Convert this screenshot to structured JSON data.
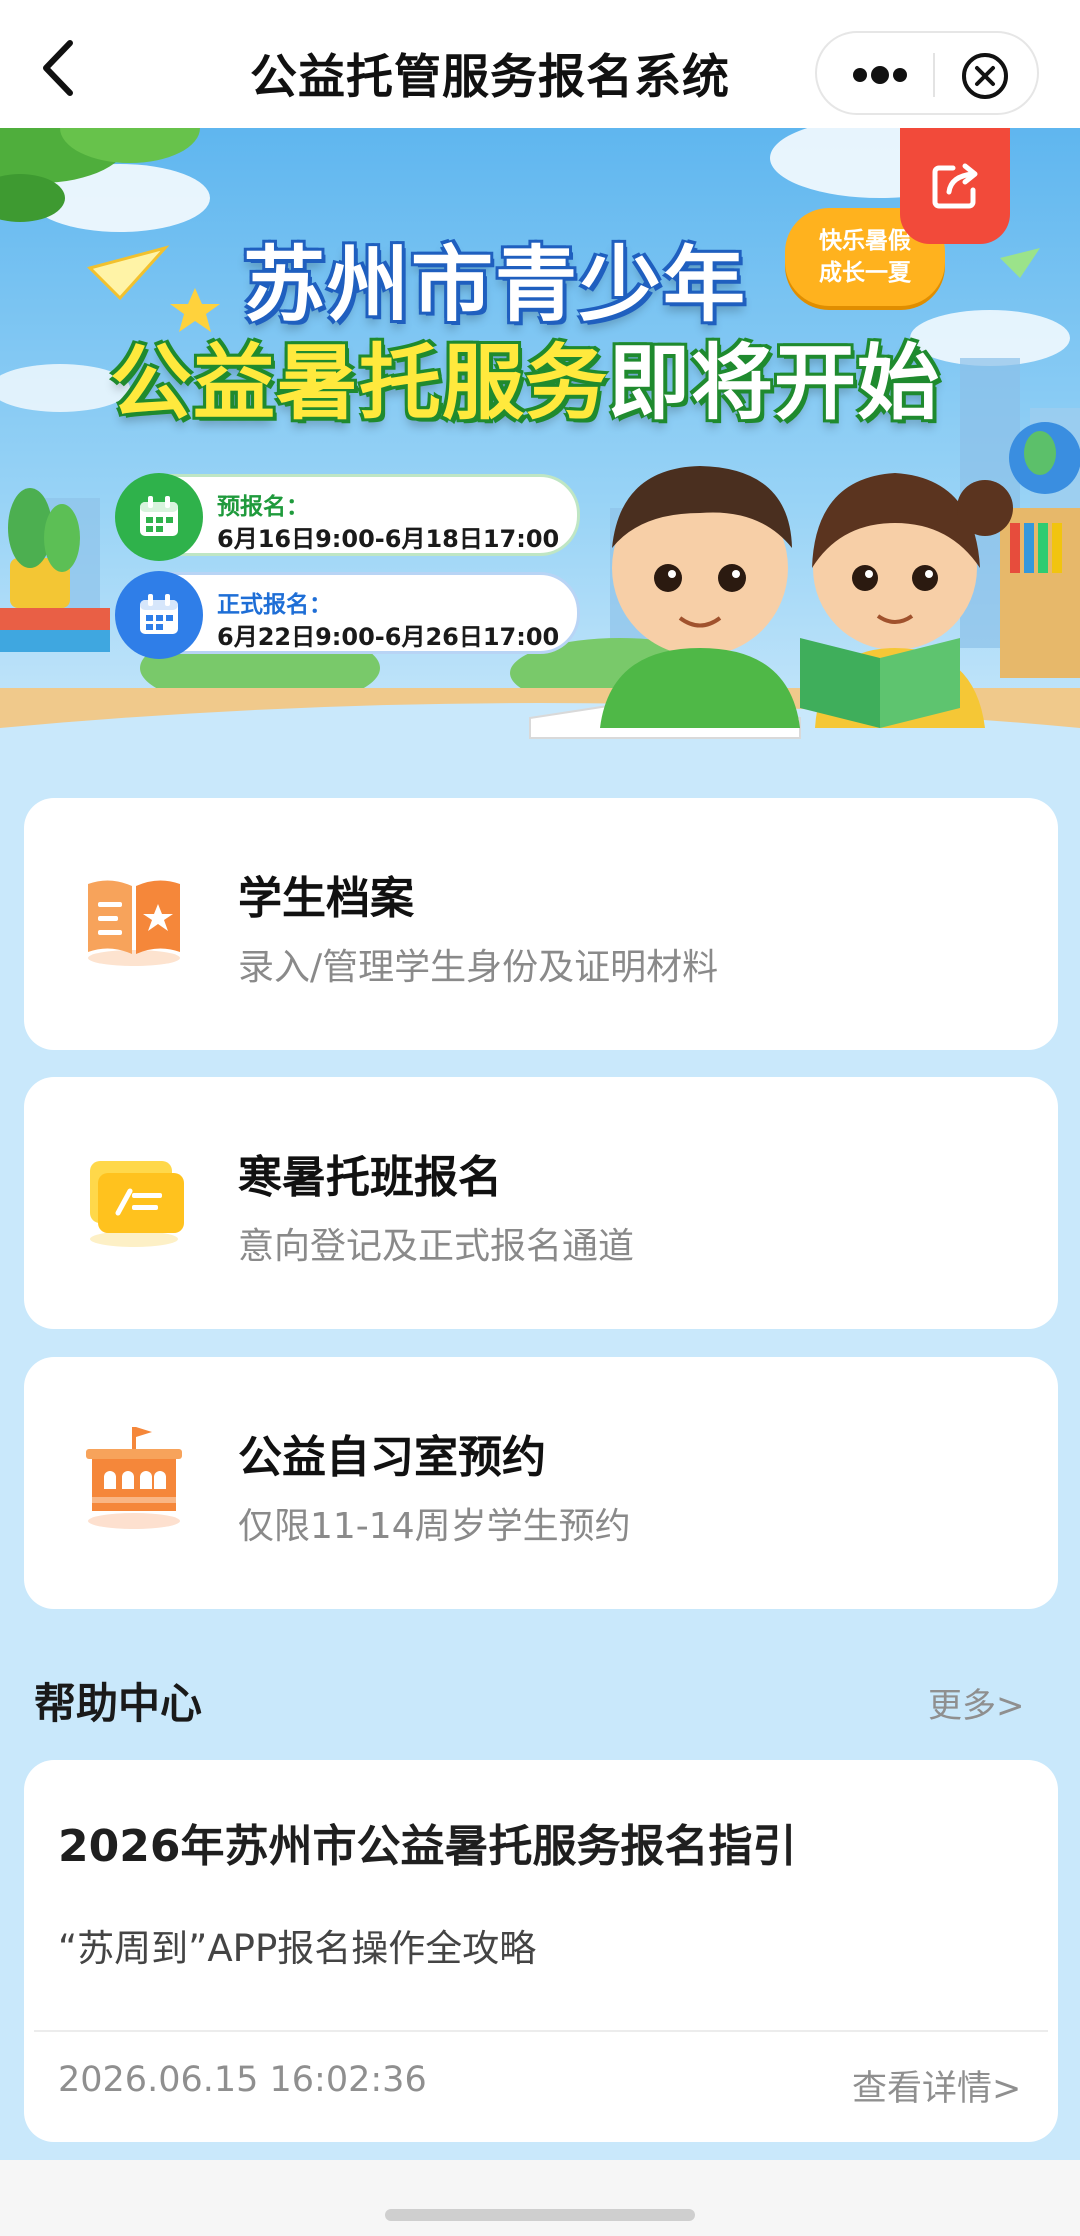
{
  "navbar": {
    "title": "公益托管服务报名系统",
    "back_icon": "chevron-left-icon",
    "more_icon": "more-dots-icon",
    "close_icon": "close-circle-icon"
  },
  "banner": {
    "headline_1": "苏州市青少年",
    "headline_2_part1": "公益暑托服务",
    "headline_2_part2": "即将开始",
    "bubble_line1": "快乐暑假",
    "bubble_line2": "成长一夏",
    "share_icon": "share-icon",
    "pre_registration": {
      "label": "预报名：",
      "date": "6月16日9:00-6月18日17:00"
    },
    "formal_registration": {
      "label": "正式报名：",
      "date": "6月22日9:00-6月26日17:00"
    }
  },
  "cards": [
    {
      "title": "学生档案",
      "subtitle": "录入/管理学生身份及证明材料",
      "icon": "student-file-icon"
    },
    {
      "title": "寒暑托班报名",
      "subtitle": "意向登记及正式报名通道",
      "icon": "registration-form-icon"
    },
    {
      "title": "公益自习室预约",
      "subtitle": "仅限11-14周岁学生预约",
      "icon": "study-room-icon"
    }
  ],
  "help_center": {
    "title": "帮助中心",
    "more": "更多>",
    "article": {
      "title": "2026年苏州市公益暑托服务报名指引",
      "subtitle": "“苏周到”APP报名操作全攻略",
      "time": "2026.06.15 16:02:36",
      "link": "查看详情>"
    }
  },
  "colors": {
    "page_bg": "#c9e8fb",
    "share_red": "#f24a3a",
    "green": "#2fb24b",
    "blue": "#2f7ee8",
    "orange": "#f5873a"
  }
}
